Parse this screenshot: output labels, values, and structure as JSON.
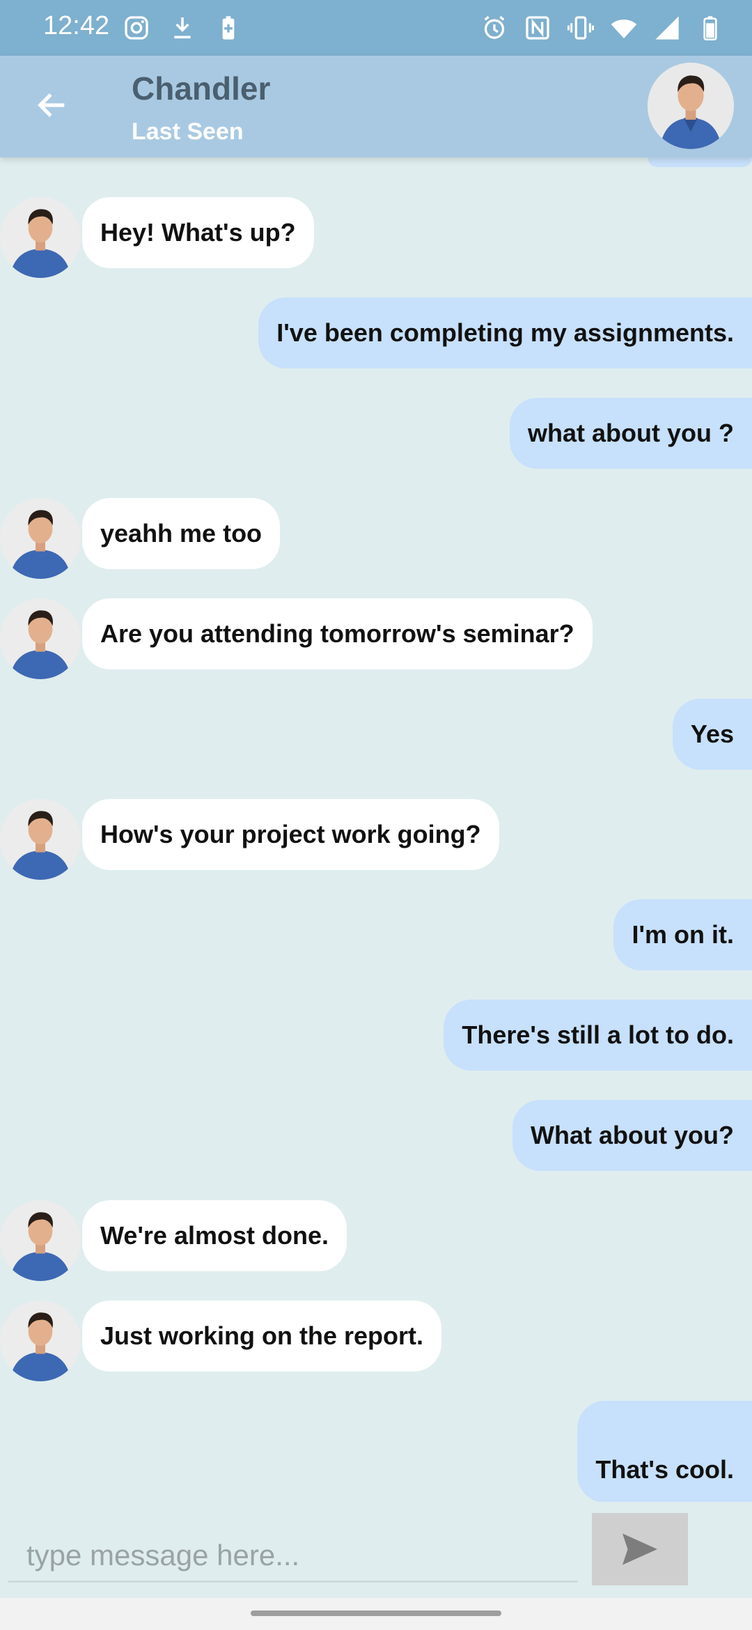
{
  "status_bar": {
    "time": "12:42",
    "left_icons": [
      "instagram-icon",
      "download-icon",
      "battery-saver-icon"
    ],
    "right_icons": [
      "alarm-icon",
      "nfc-icon",
      "vibrate-icon",
      "wifi-icon",
      "signal-icon",
      "battery-icon"
    ]
  },
  "header": {
    "contact_name": "Chandler",
    "status": "Last Seen"
  },
  "messages": [
    {
      "side": "in",
      "text": "Hey! What's up?"
    },
    {
      "side": "out",
      "text": "I've been completing my assignments."
    },
    {
      "side": "out",
      "text": "what about you ?"
    },
    {
      "side": "in",
      "text": "yeahh me too"
    },
    {
      "side": "in",
      "text": "Are you attending tomorrow's seminar?"
    },
    {
      "side": "out",
      "text": "Yes"
    },
    {
      "side": "in",
      "text": "How's your project work going?"
    },
    {
      "side": "out",
      "text": "I'm on it."
    },
    {
      "side": "out",
      "text": "There's still a lot to do."
    },
    {
      "side": "out",
      "text": "What about you?"
    },
    {
      "side": "in",
      "text": "We're almost done."
    },
    {
      "side": "in",
      "text": "Just working on the report."
    },
    {
      "side": "out",
      "text": "That's cool."
    }
  ],
  "composer": {
    "placeholder": "type message here..."
  },
  "colors": {
    "status_bar": "#7eb0cf",
    "header": "#a9c9e2",
    "background": "#dfedee",
    "incoming_bubble": "#ffffff",
    "outgoing_bubble": "#c7e0fb"
  }
}
